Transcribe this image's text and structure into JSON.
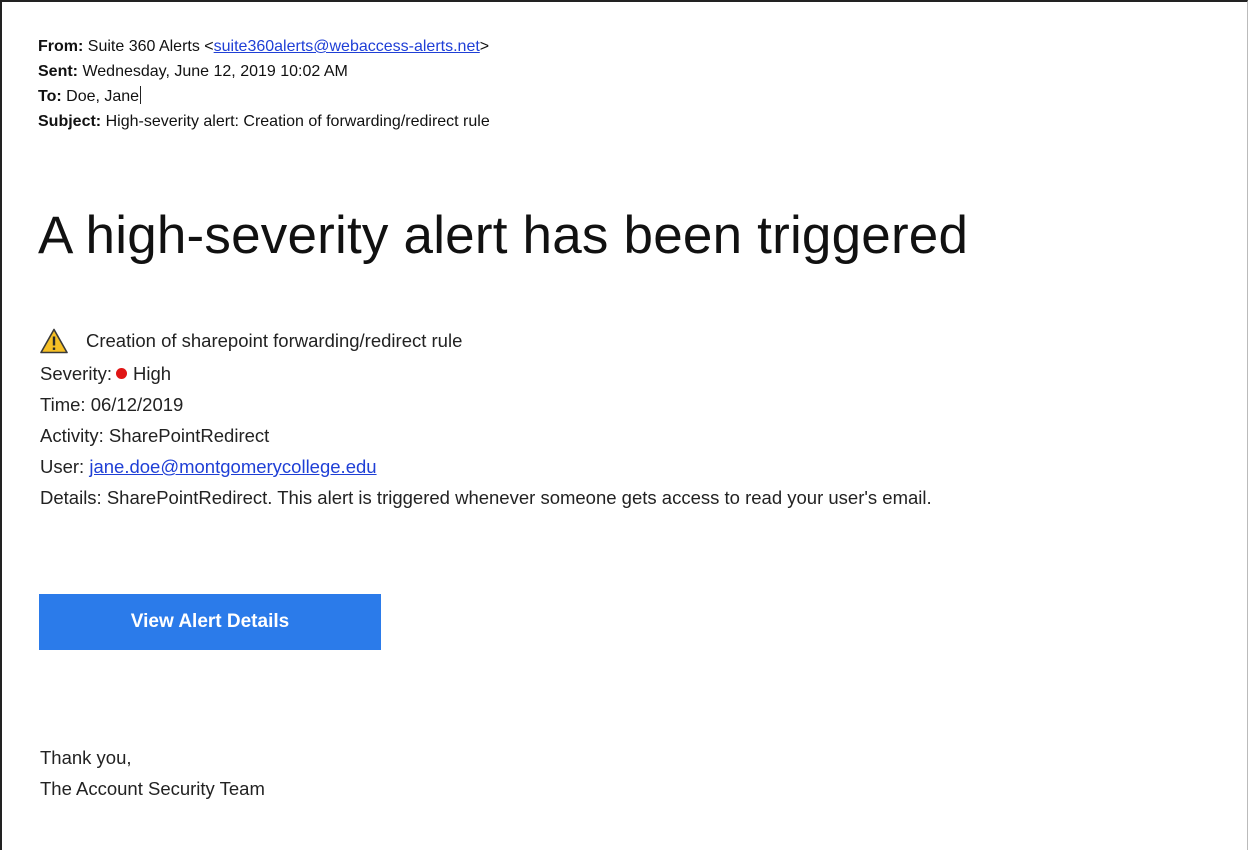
{
  "header": {
    "from_label": "From:",
    "from_name": "Suite 360 Alerts <",
    "from_email": "suite360alerts@webaccess-alerts.net",
    "from_close": ">",
    "sent_label": "Sent:",
    "sent_value": "Wednesday, June 12, 2019 10:02 AM",
    "to_label": "To:",
    "to_value": "Doe, Jane",
    "subject_label": "Subject:",
    "subject_value": "High-severity alert: Creation of forwarding/redirect rule"
  },
  "title": "A high-severity alert has been triggered",
  "alert": {
    "icon": "warning-icon",
    "description": "Creation of sharepoint forwarding/redirect rule",
    "severity_label": "Severity:",
    "severity_value": "High",
    "severity_color": "#e01515",
    "time_label": "Time:",
    "time_value": "06/12/2019",
    "activity_label": "Activity:",
    "activity_value": "SharePointRedirect",
    "user_label": "User:",
    "user_email": "jane.doe@montgomerycollege.edu",
    "details_label": "Details:",
    "details_value": "SharePointRedirect. This alert is triggered whenever someone gets access to read your user's email."
  },
  "button": {
    "label": "View Alert Details",
    "color": "#2b7bea"
  },
  "closing": {
    "line1": "Thank you,",
    "line2": "The Account Security Team"
  }
}
